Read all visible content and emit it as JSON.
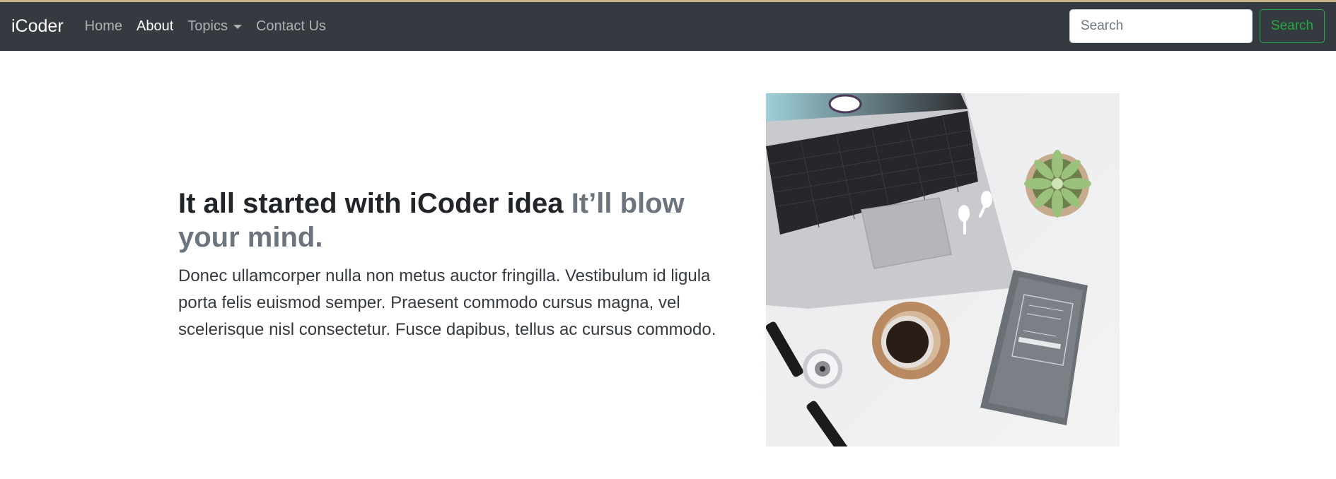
{
  "navbar": {
    "brand": "iCoder",
    "links": [
      {
        "label": "Home"
      },
      {
        "label": "About"
      },
      {
        "label": "Topics"
      },
      {
        "label": "Contact Us"
      }
    ],
    "search": {
      "placeholder": "Search",
      "button_label": "Search"
    }
  },
  "featurette": {
    "heading": "It all started with iCoder idea",
    "heading_muted": "It’ll blow your mind.",
    "lead": "Donec ullamcorper nulla non metus auctor fringilla. Vestibulum id ligula porta felis euismod semper. Praesent commodo cursus magna, vel scelerisque nisl consectetur. Fusce dapibus, tellus ac cursus commodo."
  },
  "colors": {
    "navbar_bg": "#343a40",
    "search_button": "#28a745",
    "muted_text": "#6c757d"
  }
}
